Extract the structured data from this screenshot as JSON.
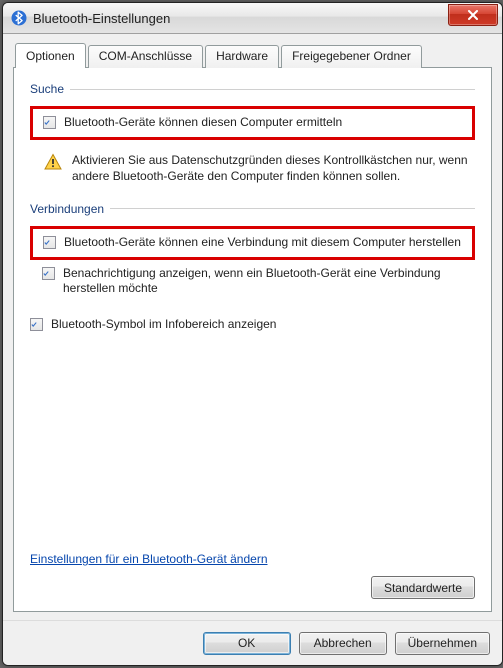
{
  "window": {
    "title": "Bluetooth-Einstellungen"
  },
  "tabs": [
    {
      "label": "Optionen",
      "active": true
    },
    {
      "label": "COM-Anschlüsse",
      "active": false
    },
    {
      "label": "Hardware",
      "active": false
    },
    {
      "label": "Freigegebener Ordner",
      "active": false
    }
  ],
  "groups": {
    "search": {
      "title": "Suche",
      "discover_label": "Bluetooth-Geräte können diesen Computer ermitteln",
      "discover_checked": true,
      "warning_text": "Aktivieren Sie aus Datenschutzgründen dieses Kontrollkästchen nur, wenn andere Bluetooth-Geräte den Computer finden können sollen."
    },
    "connections": {
      "title": "Verbindungen",
      "allow_connect_label": "Bluetooth-Geräte können eine Verbindung mit diesem Computer herstellen",
      "allow_connect_checked": true,
      "notify_label": "Benachrichtigung anzeigen, wenn ein Bluetooth-Gerät eine Verbindung herstellen möchte",
      "notify_checked": true
    },
    "tray": {
      "show_icon_label": "Bluetooth-Symbol im Infobereich anzeigen",
      "show_icon_checked": true
    }
  },
  "link_text": "Einstellungen für ein Bluetooth-Gerät ändern",
  "buttons": {
    "defaults": "Standardwerte",
    "ok": "OK",
    "cancel": "Abbrechen",
    "apply": "Übernehmen"
  }
}
